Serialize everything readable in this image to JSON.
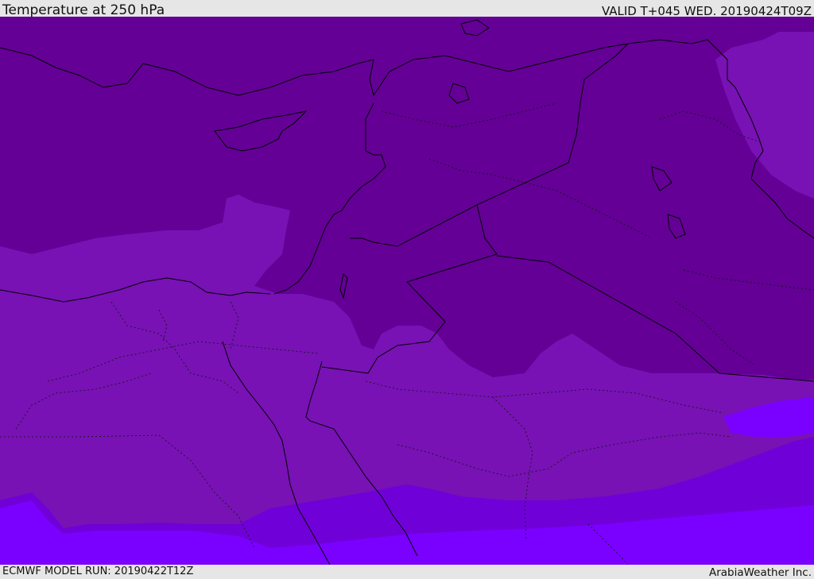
{
  "header": {
    "title": "Temperature at 250 hPa",
    "valid_time": "VALID T+045 WED. 20190424T09Z"
  },
  "footer": {
    "model_run": "ECMWF MODEL RUN: 20190422T12Z",
    "brand": "ArabiaWeather Inc."
  },
  "map": {
    "colors": {
      "coldest_band": "#640096",
      "band_2": "#7812b4",
      "band_3": "#7000d8",
      "warmest_band": "#7a00ff",
      "coastline": "#000000"
    }
  }
}
